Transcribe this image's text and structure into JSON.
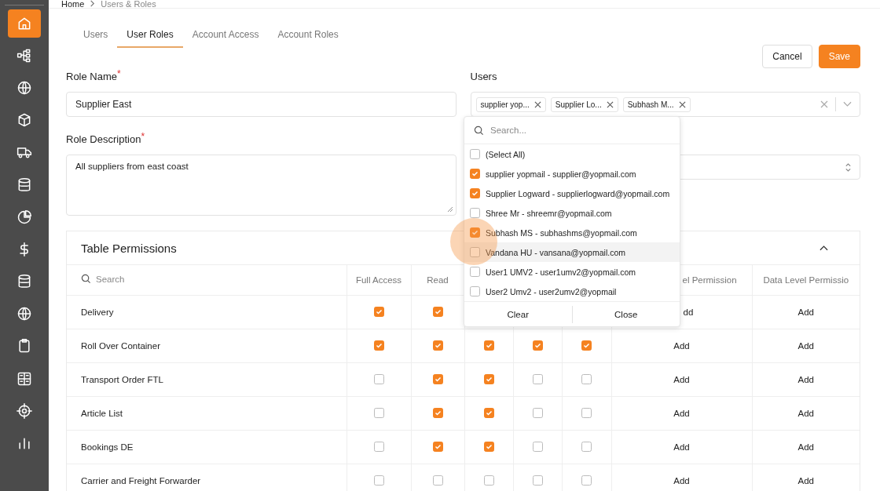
{
  "sidebar": {
    "items": [
      {
        "kind": "home",
        "selected": true
      },
      {
        "kind": "hierarchy",
        "selected": false
      },
      {
        "kind": "globe",
        "selected": false
      },
      {
        "kind": "cube",
        "selected": false
      },
      {
        "kind": "truck",
        "selected": false
      },
      {
        "kind": "database",
        "selected": false
      },
      {
        "kind": "pie",
        "selected": false
      },
      {
        "kind": "dollar",
        "selected": false
      },
      {
        "kind": "database",
        "selected": false
      },
      {
        "kind": "globe",
        "selected": false
      },
      {
        "kind": "clipboard",
        "selected": false
      },
      {
        "kind": "grid",
        "selected": false
      },
      {
        "kind": "target",
        "selected": false
      },
      {
        "kind": "bars",
        "selected": false
      }
    ]
  },
  "breadcrumb": [
    "Home",
    "Users & Roles"
  ],
  "tabs": [
    {
      "label": "Users",
      "selected": false
    },
    {
      "label": "User Roles",
      "selected": true
    },
    {
      "label": "Account Access",
      "selected": false
    },
    {
      "label": "Account Roles",
      "selected": false
    }
  ],
  "buttons": {
    "cancel": "Cancel",
    "save": "Save"
  },
  "role_name": {
    "label": "Role Name",
    "required_mark": "*",
    "value": "Supplier East"
  },
  "role_description": {
    "label": "Role Description",
    "required_mark": "*",
    "value": "All suppliers from east coast"
  },
  "users": {
    "label": "Users",
    "tags": [
      "supplier yop...",
      "Supplier Lo...",
      "Subhash M..."
    ]
  },
  "dropdown": {
    "placeholder": "Search...",
    "options": [
      {
        "label": "(Select All)",
        "checked": false,
        "hovered": false
      },
      {
        "label": "supplier yopmail - supplier@yopmail.com",
        "checked": true,
        "hovered": false
      },
      {
        "label": "Supplier Logward - supplierlogward@yopmail.com",
        "checked": true,
        "hovered": false
      },
      {
        "label": "Shree Mr - shreemr@yopmail.com",
        "checked": false,
        "hovered": false
      },
      {
        "label": "Subhash MS - subhashms@yopmail.com",
        "checked": true,
        "hovered": false
      },
      {
        "label": "Vandana HU - vansana@yopmail.com",
        "checked": false,
        "hovered": true
      },
      {
        "label": "User1 UMV2 - user1umv2@yopmail.com",
        "checked": false,
        "hovered": false
      },
      {
        "label": "User2 Umv2 - user2umv2@yopmail",
        "checked": false,
        "hovered": false
      }
    ],
    "clear": "Clear",
    "close": "Close"
  },
  "table": {
    "title": "Table Permissions",
    "expanded": true,
    "search_placeholder": "Search",
    "columns": [
      "Full Access",
      "Read"
    ],
    "column_6": "el Permission",
    "column_7": "Data Level Permissio",
    "rows": [
      {
        "name": "Delivery",
        "checks": [
          true,
          true
        ],
        "column_6": "dd",
        "column_7": "Add"
      },
      {
        "name": "Roll Over Container",
        "checks": [
          true,
          true,
          true,
          true,
          true
        ],
        "column_6": "Add",
        "column_7": "Add"
      },
      {
        "name": "Transport Order FTL",
        "checks": [
          false,
          true,
          true,
          false,
          false
        ],
        "column_6": "Add",
        "column_7": "Add"
      },
      {
        "name": "Article List",
        "checks": [
          false,
          true,
          true,
          false,
          false
        ],
        "column_6": "Add",
        "column_7": "Add"
      },
      {
        "name": "Bookings DE",
        "checks": [
          false,
          true,
          true,
          false,
          false
        ],
        "column_6": "Add",
        "column_7": "Add"
      },
      {
        "name": "Carrier and Freight Forwarder",
        "checks": [
          false,
          false,
          false,
          false,
          false
        ],
        "column_6": "Add",
        "column_7": "Add"
      }
    ]
  }
}
